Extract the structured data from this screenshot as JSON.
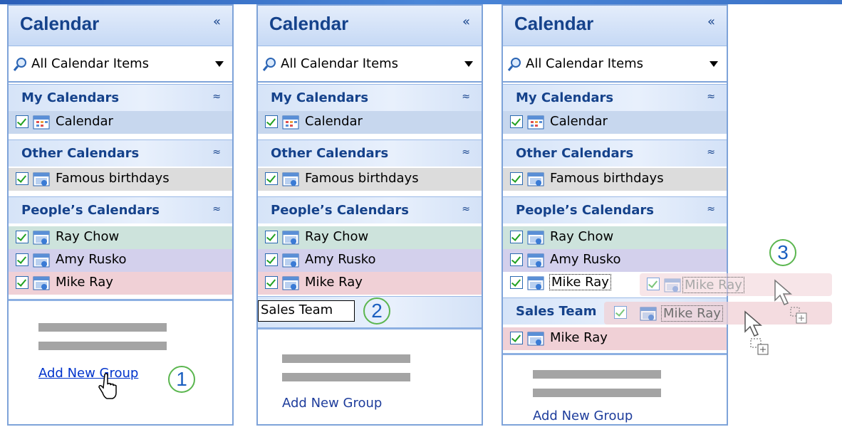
{
  "panels": [
    {
      "title": "Calendar",
      "collapse_icon": "«",
      "view": "All Calendar Items",
      "sections": [
        "My Calendars",
        "Other Calendars",
        "People’s Calendars"
      ],
      "my_calendars": [
        "Calendar"
      ],
      "other_calendars": [
        "Famous birthdays"
      ],
      "people_calendars": [
        "Ray Chow",
        "Amy Rusko",
        "Mike Ray"
      ],
      "add_group": "Add New Group",
      "step": "1"
    },
    {
      "title": "Calendar",
      "collapse_icon": "«",
      "view": "All Calendar Items",
      "sections": [
        "My Calendars",
        "Other Calendars",
        "People’s Calendars"
      ],
      "my_calendars": [
        "Calendar"
      ],
      "other_calendars": [
        "Famous birthdays"
      ],
      "people_calendars": [
        "Ray Chow",
        "Amy Rusko",
        "Mike Ray"
      ],
      "new_group_input": "Sales Team",
      "add_group": "Add New Group",
      "step": "2"
    },
    {
      "title": "Calendar",
      "collapse_icon": "«",
      "view": "All Calendar Items",
      "sections": [
        "My Calendars",
        "Other Calendars",
        "People’s Calendars",
        "Sales Team"
      ],
      "my_calendars": [
        "Calendar"
      ],
      "other_calendars": [
        "Famous birthdays"
      ],
      "people_calendars": [
        "Ray Chow",
        "Amy Rusko",
        "Mike Ray"
      ],
      "sales_team": [
        "Mike Ray"
      ],
      "drag_ghost": "Mike Ray",
      "add_group": "Add New Group",
      "step": "3"
    }
  ],
  "colors": {
    "title_text": "#15428b",
    "ray_chow": "#cde3dc",
    "amy_rusko": "#d3d0ec",
    "mike_ray": "#f0d0d6",
    "calendar_row": "#c7d7ee",
    "famous_row": "#dcdcdc",
    "accent_circle": "#5bb64f"
  },
  "icons": [
    "magnifier-icon",
    "collapse-icon",
    "dropdown-arrow-icon",
    "checkbox-icon",
    "calendar-icon",
    "shared-calendar-icon",
    "expand-chevron-icon",
    "hand-cursor-icon",
    "arrow-cursor-icon"
  ]
}
